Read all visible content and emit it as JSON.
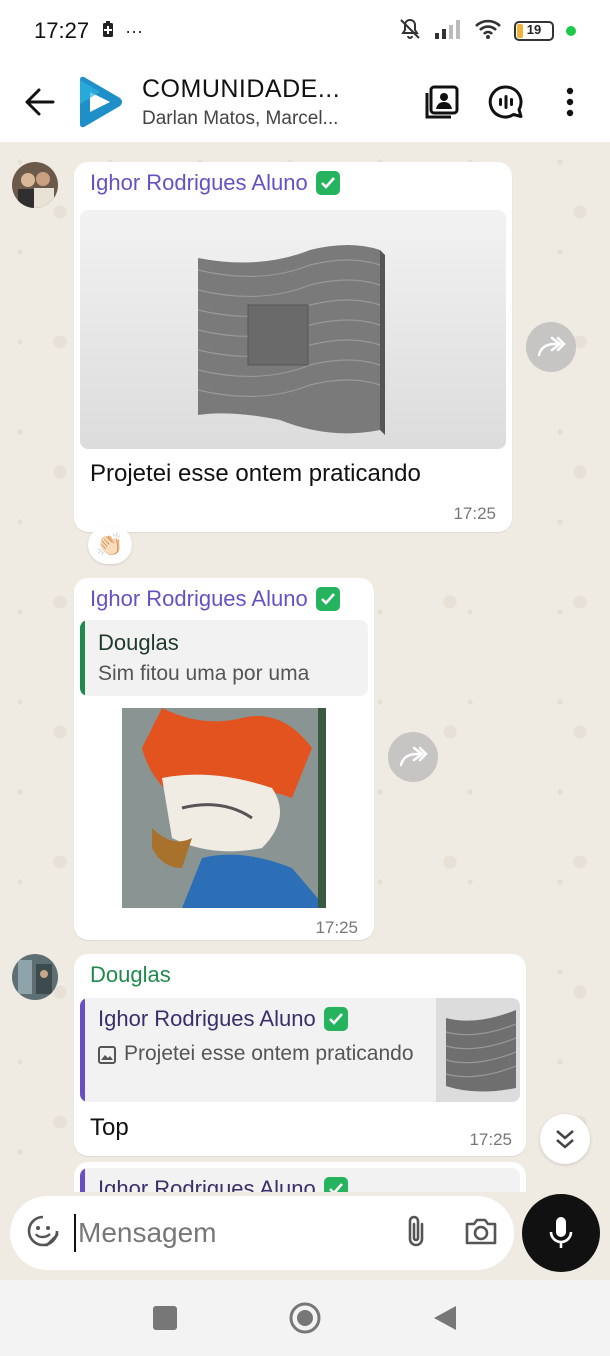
{
  "status_bar": {
    "time": "17:27",
    "more": "···",
    "battery": "19",
    "battery_percent": 19,
    "colors": {
      "battery_fill": "#f2b138",
      "dot": "#1ec84a"
    }
  },
  "header": {
    "title": "COMUNIDADE...",
    "subtitle": "Darlan Matos, Marcel...",
    "icons": [
      "back-arrow-icon",
      "group-logo",
      "gallery-icon",
      "call-icon",
      "more-vertical-icon"
    ]
  },
  "messages": [
    {
      "sender": "Ighor Rodrigues Aluno",
      "text": "Projetei esse ontem praticando",
      "time": "17:25",
      "reaction": "👏🏻",
      "has_image": true
    },
    {
      "sender": "Ighor Rodrigues Aluno",
      "quote_name": "Douglas",
      "quote_text": "Sim fitou uma por uma",
      "time": "17:25",
      "has_sticker": true
    },
    {
      "sender": "Douglas",
      "quote_name": "Ighor Rodrigues Aluno",
      "quote_text": "Projetei esse ontem praticando",
      "text": "Top",
      "time": "17:25"
    },
    {
      "sender": "Ighor Rodrigues Aluno"
    }
  ],
  "input": {
    "placeholder": "Mensagem"
  },
  "colors": {
    "chat_bg": "#efeae2",
    "sender_purple": "#6a4fc4",
    "sender_green": "#1f8a4c",
    "verified": "#25b35e"
  }
}
